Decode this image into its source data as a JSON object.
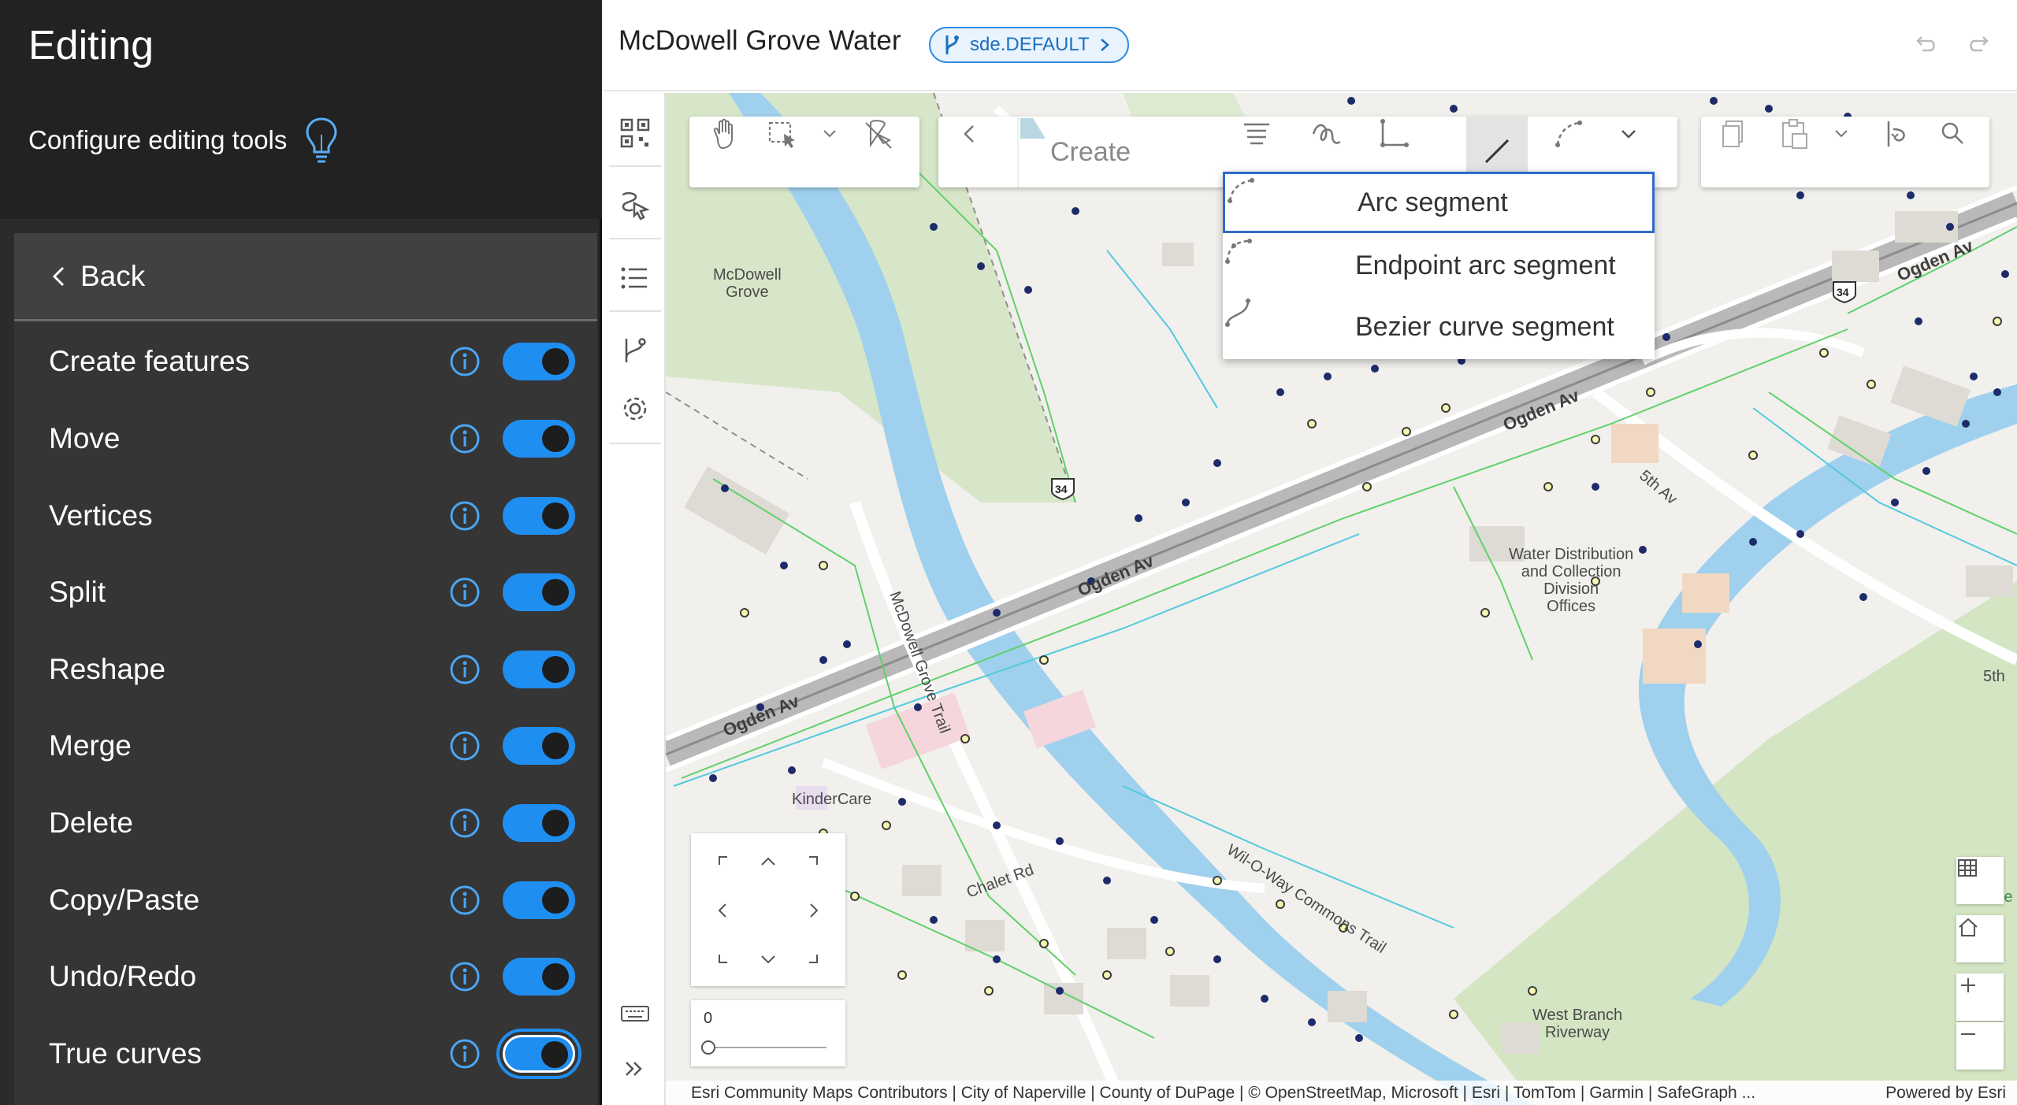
{
  "panel": {
    "title": "Editing",
    "subtitle": "Configure editing tools",
    "back_label": "Back",
    "tools": [
      {
        "label": "Create features",
        "enabled": true
      },
      {
        "label": "Move",
        "enabled": true
      },
      {
        "label": "Vertices",
        "enabled": true
      },
      {
        "label": "Split",
        "enabled": true
      },
      {
        "label": "Reshape",
        "enabled": true
      },
      {
        "label": "Merge",
        "enabled": true
      },
      {
        "label": "Delete",
        "enabled": true
      },
      {
        "label": "Copy/Paste",
        "enabled": true
      },
      {
        "label": "Undo/Redo",
        "enabled": true
      },
      {
        "label": "True curves",
        "enabled": true
      }
    ]
  },
  "header": {
    "map_title": "McDowell Grove Water",
    "branch": "sde.DEFAULT"
  },
  "toolbar": {
    "create_label": "Create"
  },
  "segment_menu": {
    "items": [
      {
        "label": "Arc segment",
        "selected": true
      },
      {
        "label": "Endpoint arc segment",
        "selected": false
      },
      {
        "label": "Bezier curve segment",
        "selected": false
      }
    ]
  },
  "map": {
    "labels": {
      "mcdowell_grove": "McDowell\nGrove",
      "trail": "McDowell Grove Trail",
      "offices": "Water Distribution\nand Collection\nDivision\nOffices",
      "kindercare": "KinderCare",
      "chalet": "Chalet Rd",
      "willoway": "Wil-O-Way Commons Trail",
      "west_branch": "West Branch\nRiverway",
      "ogden_1": "Ogden Av",
      "ogden_2": "Ogden Av",
      "ogden_3": "Ogden Av",
      "ogden_4": "Ogden Av",
      "fifth_av": "5th Av",
      "fifth": "5th",
      "route_34": "34",
      "he": "He"
    },
    "zoom_value": "0",
    "attribution": "Esri Community Maps Contributors | City of Naperville | County of DuPage | © OpenStreetMap, Microsoft | Esri | TomTom | Garmin | SafeGraph ...",
    "powered_by": "Powered by Esri"
  },
  "colors": {
    "accent": "#1f8ef1",
    "panel_bg": "#2b2b2b",
    "water": "#a8d4f0",
    "park": "#cfe3c0"
  }
}
